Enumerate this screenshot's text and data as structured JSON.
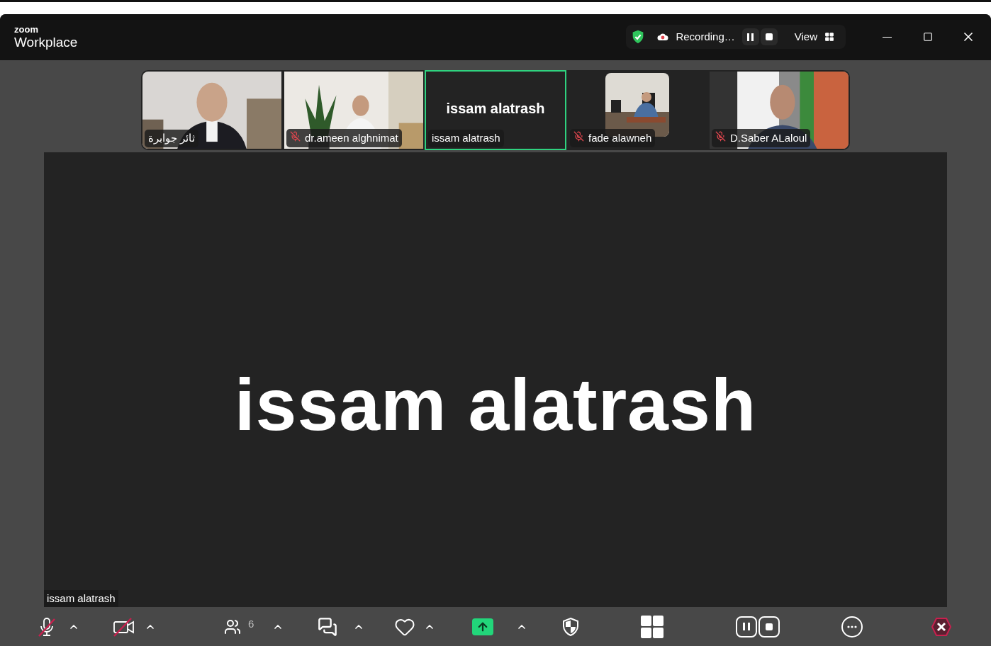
{
  "window": {
    "brand": "zoom",
    "product": "Workplace"
  },
  "recording": {
    "label": "Recording…",
    "paused": false
  },
  "view_button": {
    "label": "View"
  },
  "tiles": [
    {
      "name": "ثائر جوابرة",
      "muted": false,
      "selected": false,
      "kind": "video"
    },
    {
      "name": "dr.ameen alghnimat",
      "muted": true,
      "selected": false,
      "kind": "video"
    },
    {
      "name": "issam alatrash",
      "muted": false,
      "selected": true,
      "kind": "name",
      "display_name": "issam alatrash"
    },
    {
      "name": "fade alawneh",
      "muted": true,
      "selected": false,
      "kind": "inset"
    },
    {
      "name": "D.Saber ALaloul",
      "muted": true,
      "selected": false,
      "kind": "video"
    }
  ],
  "main_view": {
    "display_name": "issam alatrash",
    "name_label": "issam alatrash"
  },
  "toolbar": {
    "audio_muted": true,
    "video_off": true,
    "participants_count": "6"
  }
}
